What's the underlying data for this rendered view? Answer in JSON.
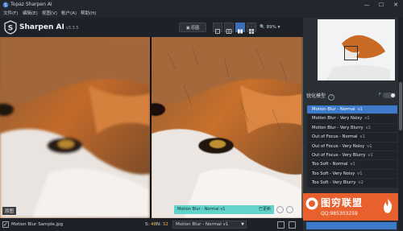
{
  "window": {
    "title": "Topaz Sharpen AI",
    "minimize": "—",
    "maximize": "☐",
    "close": "✕"
  },
  "menu": [
    "文件(F)",
    "编辑(E)",
    "视图(V)",
    "帐户(A)",
    "帮助(H)"
  ],
  "brand": {
    "name": "Sharpen AI",
    "version": "v3.3.5"
  },
  "toolbar": {
    "compare_label": "原图",
    "zoom": "89%",
    "zoom_arrow": "▾"
  },
  "preview": {
    "original_label": "原图"
  },
  "status": {
    "model": "Motion Blur - Normal v1",
    "state": "已更新"
  },
  "bottom": {
    "filename": "Motion Blur Sample.jpg",
    "s_label": "S:",
    "s_value": "48",
    "n_label": "N:",
    "n_value": "32",
    "g_label": "G:",
    "g_value": "0",
    "model_select": "Motion Blur - Normal v1"
  },
  "right_panel": {
    "section_title": "锐化模型",
    "help": "?",
    "toggle_mark": "F",
    "models": [
      {
        "name": "Motion Blur - Normal",
        "version": "v1",
        "active": true
      },
      {
        "name": "Motion Blur - Very Noisy",
        "version": "v1"
      },
      {
        "name": "Motion Blur - Very Blurry",
        "version": "v2"
      },
      {
        "name": "Out of Focus - Normal",
        "version": "v1"
      },
      {
        "name": "Out of Focus - Very Noisy",
        "version": "v1"
      },
      {
        "name": "Out of Focus - Very Blurry",
        "version": "v1"
      },
      {
        "name": "Too Soft - Normal",
        "version": "v1"
      },
      {
        "name": "Too Soft - Very Noisy",
        "version": "v1"
      },
      {
        "name": "Too Soft - Very Blurry",
        "version": "v2"
      }
    ]
  },
  "promo": {
    "title": "图穷联盟",
    "qq": "QQ:985303259"
  },
  "colors": {
    "accent": "#3d7ac9",
    "status": "#5ad2c8",
    "promo": "#e8602e"
  }
}
